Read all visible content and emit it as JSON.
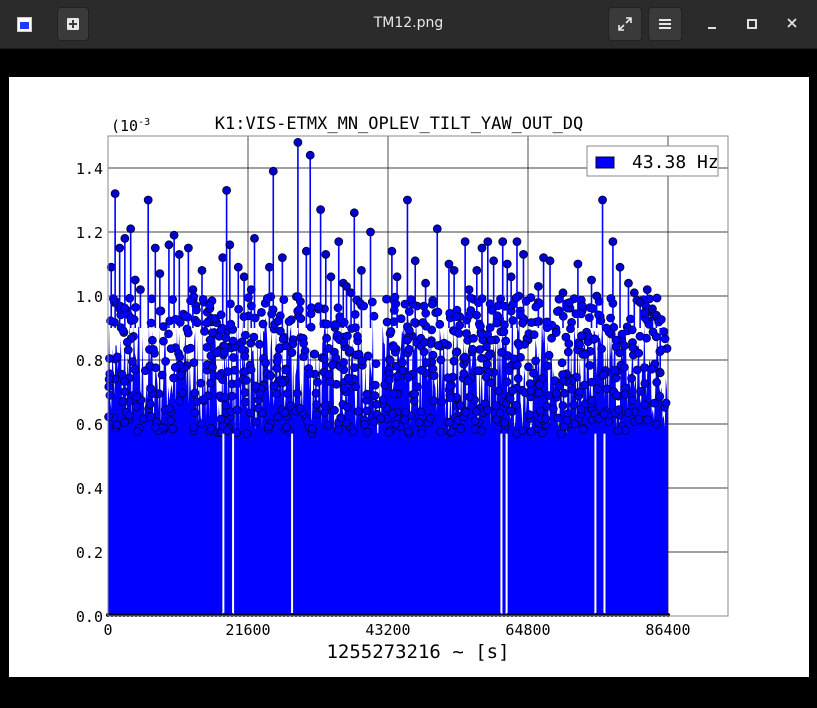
{
  "window": {
    "title": "TM12.png"
  },
  "toolbar": {
    "app_icon": "image-viewer-icon",
    "new_icon": "plus-box-icon",
    "expand_icon": "expand-arrows-icon",
    "menu_icon": "hamburger-menu-icon",
    "minimize_icon": "minimize-icon",
    "maximize_icon": "maximize-icon",
    "close_icon": "close-icon"
  },
  "chart_data": {
    "type": "line",
    "title": "K1:VIS-ETMX_MN_OPLEV_TILT_YAW_OUT_DQ",
    "y_multiplier": "(10",
    "y_multiplier_exp": "-3",
    "xlabel": "1255273216 ~ [s]",
    "ylabel": "",
    "xlim": [
      0,
      86400
    ],
    "ylim": [
      0.0,
      1.5
    ],
    "x_ticks": [
      "0",
      "21600",
      "43200",
      "64800",
      "86400"
    ],
    "y_ticks": [
      "0.0",
      "0.2",
      "0.4",
      "0.6",
      "0.8",
      "1.0",
      "1.2",
      "1.4"
    ],
    "grid": true,
    "legend_position": "top-right",
    "series": [
      {
        "name": "43.38 Hz",
        "color": "#0000ff",
        "marker_color": "#0000cc",
        "baseline_min": 0.57,
        "baseline_max": 1.0,
        "x": [
          500,
          1100,
          1800,
          2600,
          3500,
          4200,
          5000,
          6200,
          7300,
          8000,
          9400,
          10200,
          11000,
          12400,
          13100,
          14500,
          17700,
          18300,
          18800,
          20100,
          21000,
          22100,
          22600,
          24900,
          25500,
          26900,
          29300,
          30600,
          31200,
          32800,
          33600,
          34400,
          35600,
          36300,
          36800,
          37500,
          38000,
          39100,
          40500,
          43800,
          44600,
          46200,
          47400,
          49000,
          50800,
          52600,
          53400,
          55100,
          55700,
          56900,
          57700,
          58600,
          59500,
          60900,
          61600,
          62200,
          63100,
          64100,
          66400,
          67200,
          68200,
          70200,
          72500,
          74600,
          75400,
          76300,
          77900,
          79000,
          80300,
          81200,
          82100,
          83200,
          84000,
          84600,
          85200
        ],
        "peaks": [
          1.09,
          1.32,
          1.15,
          1.18,
          1.21,
          1.05,
          1.02,
          1.3,
          1.15,
          1.07,
          1.16,
          1.19,
          1.13,
          1.15,
          1.02,
          1.08,
          1.12,
          1.33,
          1.16,
          1.09,
          1.06,
          1.02,
          1.18,
          1.09,
          1.39,
          1.12,
          1.48,
          1.14,
          1.44,
          1.27,
          1.13,
          1.06,
          1.17,
          1.04,
          1.03,
          1.01,
          1.26,
          1.08,
          1.2,
          1.14,
          1.06,
          1.3,
          1.11,
          1.04,
          1.21,
          1.1,
          1.08,
          1.17,
          1.02,
          1.08,
          1.15,
          1.17,
          1.11,
          1.17,
          1.1,
          1.06,
          1.17,
          1.13,
          1.03,
          1.12,
          1.11,
          1.01,
          1.1,
          1.05,
          1.0,
          1.3,
          1.17,
          1.09,
          1.04,
          1.01,
          0.98,
          1.02,
          0.96,
          0.94,
          0.76
        ],
        "gaps_x": [
          17800,
          19300,
          28400,
          60700,
          61500,
          75200,
          76600
        ]
      }
    ]
  }
}
